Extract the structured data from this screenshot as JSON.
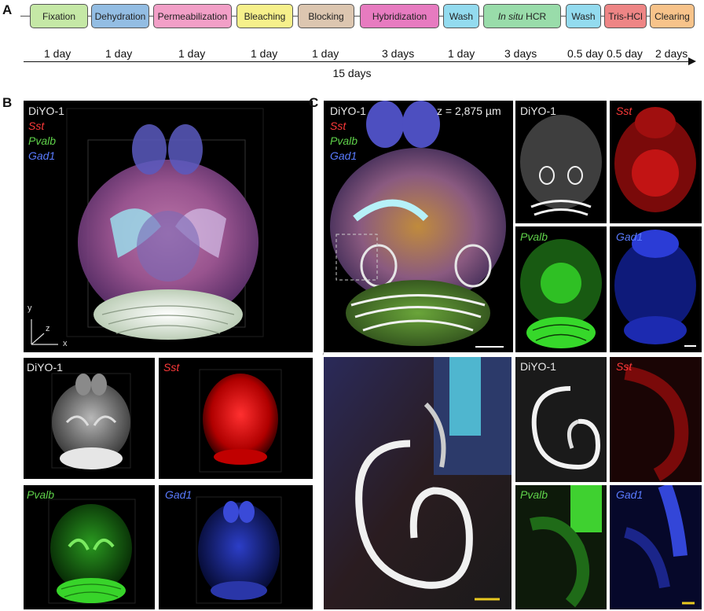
{
  "panels": {
    "a": "A",
    "b": "B",
    "c": "C"
  },
  "protocol": {
    "steps": [
      {
        "label": "Fixation",
        "color": "#c5e8a6"
      },
      {
        "label": "Dehydration",
        "color": "#93bde3"
      },
      {
        "label": "Permeabilization",
        "color": "#f29fc7"
      },
      {
        "label": "Bleaching",
        "color": "#f6f08b"
      },
      {
        "label": "Blocking",
        "color": "#dcc6b0"
      },
      {
        "label": "Hybridization",
        "color": "#e77bc0"
      },
      {
        "label": "Wash",
        "color": "#93dbef"
      },
      {
        "label_italic": "In situ",
        "label_rest": " HCR",
        "color": "#99dcaa"
      },
      {
        "label": "Wash",
        "color": "#93dbef"
      },
      {
        "label": "Tris-HCl",
        "color": "#ee8585"
      },
      {
        "label": "Clearing",
        "color": "#f7c38a"
      }
    ],
    "durations": [
      "1 day",
      "1 day",
      "1 day",
      "1 day",
      "1 day",
      "3 days",
      "1 day",
      "3 days",
      "0.5 day",
      "0.5 day",
      "2 days"
    ],
    "total": "15 days"
  },
  "channels": {
    "diyo": "DiYO-1",
    "sst": "Sst",
    "pvalb": "Pvalb",
    "gad1": "Gad1"
  },
  "axes": {
    "y": "y",
    "z": "z",
    "x": "x"
  },
  "section_depth": "z = 2,875  µm"
}
